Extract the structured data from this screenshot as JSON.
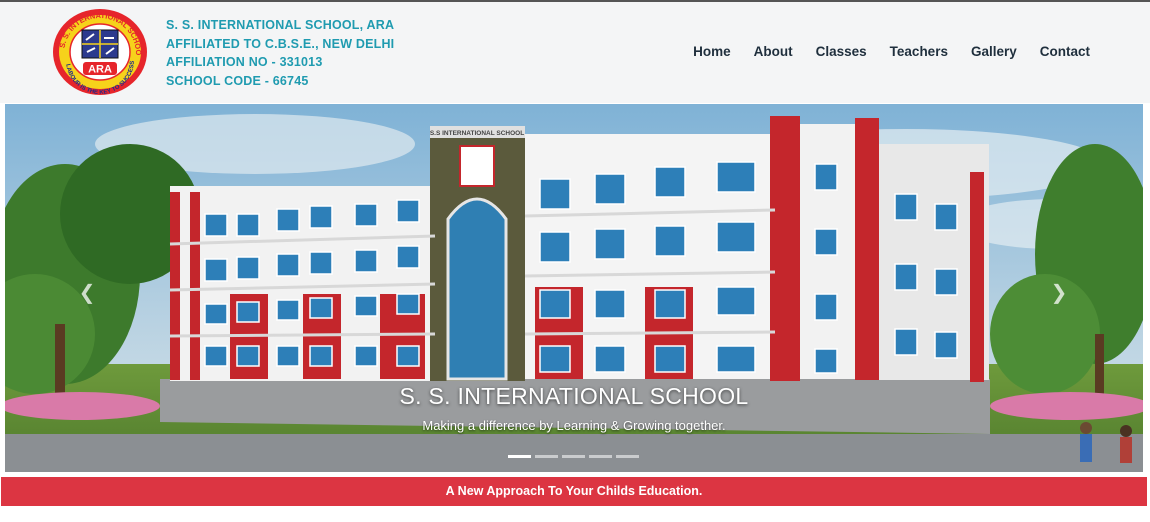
{
  "logo": {
    "ring_text_top": "S. S. INTERNATIONAL SCHOOL",
    "ring_text_bottom": "LABOUR IS THE KEY TO SUCCESS",
    "center_text": "ARA",
    "colors": {
      "ring": "#e6252b",
      "inner": "#f6d21b",
      "text": "#ffffff"
    }
  },
  "school": {
    "name": "S. S. INTERNATIONAL SCHOOL, ARA",
    "affiliation": "AFFILIATED TO C.B.S.E., NEW DELHI",
    "affiliation_no": "AFFILIATION NO - 331013",
    "school_code": "SCHOOL CODE - 66745"
  },
  "nav": {
    "items": [
      {
        "label": "Home"
      },
      {
        "label": "About"
      },
      {
        "label": "Classes"
      },
      {
        "label": "Teachers"
      },
      {
        "label": "Gallery"
      },
      {
        "label": "Contact"
      }
    ]
  },
  "hero": {
    "building_sign": "S.S INTERNATIONAL SCHOOL",
    "caption_title": "S. S. INTERNATIONAL SCHOOL",
    "caption_subtitle": "Making a difference by Learning & Growing together.",
    "prev_icon": "chevron-left-icon",
    "next_icon": "chevron-right-icon",
    "slides_count": 5,
    "active_slide": 1
  },
  "banner": {
    "text": "A New Approach To Your Childs Education."
  },
  "colors": {
    "accent_teal": "#1f9bb0",
    "nav_text": "#1f2f3d",
    "banner_red": "#dc3542",
    "header_bg": "#f4f5f6"
  }
}
